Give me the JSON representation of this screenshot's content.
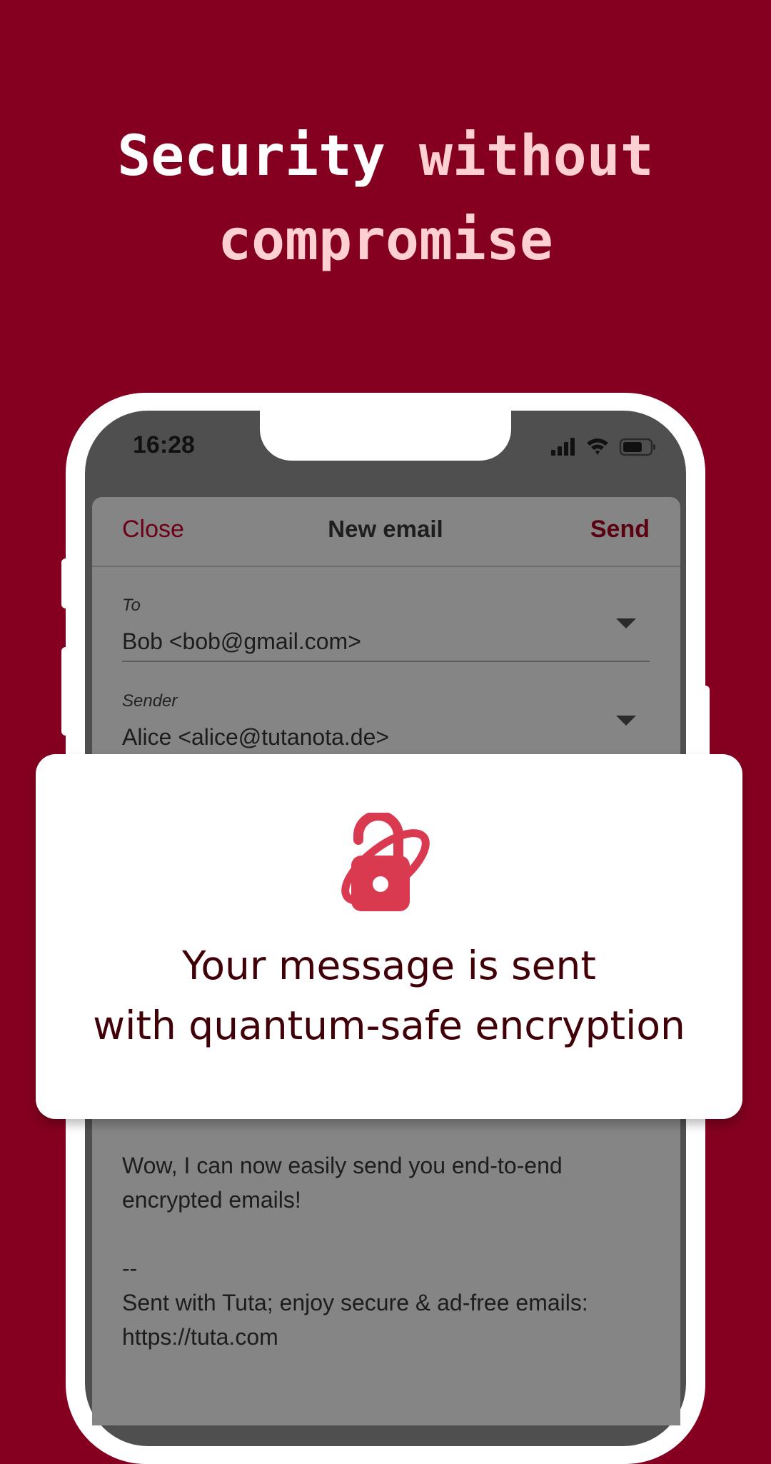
{
  "headline": {
    "line1_white": "Security",
    "line1_accent": "without",
    "line2_accent": "compromise"
  },
  "status_bar": {
    "time": "16:28",
    "icons": [
      "signal-icon",
      "wifi-icon",
      "battery-icon"
    ]
  },
  "email": {
    "close_label": "Close",
    "title": "New email",
    "send_label": "Send",
    "to_label": "To",
    "to_value": "Bob <bob@gmail.com>",
    "sender_label": "Sender",
    "sender_value": "Alice <alice@tutanota.de>",
    "body_lines": [
      "Wow, I can now easily send you end-to-end",
      "encrypted emails!",
      "",
      "--",
      "Sent with Tuta; enjoy secure & ad-free emails:",
      "https://tuta.com"
    ]
  },
  "card": {
    "icon": "quantum-lock-icon",
    "line1": "Your message is sent",
    "line2": "with quantum-safe encryption"
  },
  "colors": {
    "background": "#850020",
    "accent_text": "#ffd0d2",
    "lock_icon": "#d93a50",
    "card_text": "#410007"
  }
}
